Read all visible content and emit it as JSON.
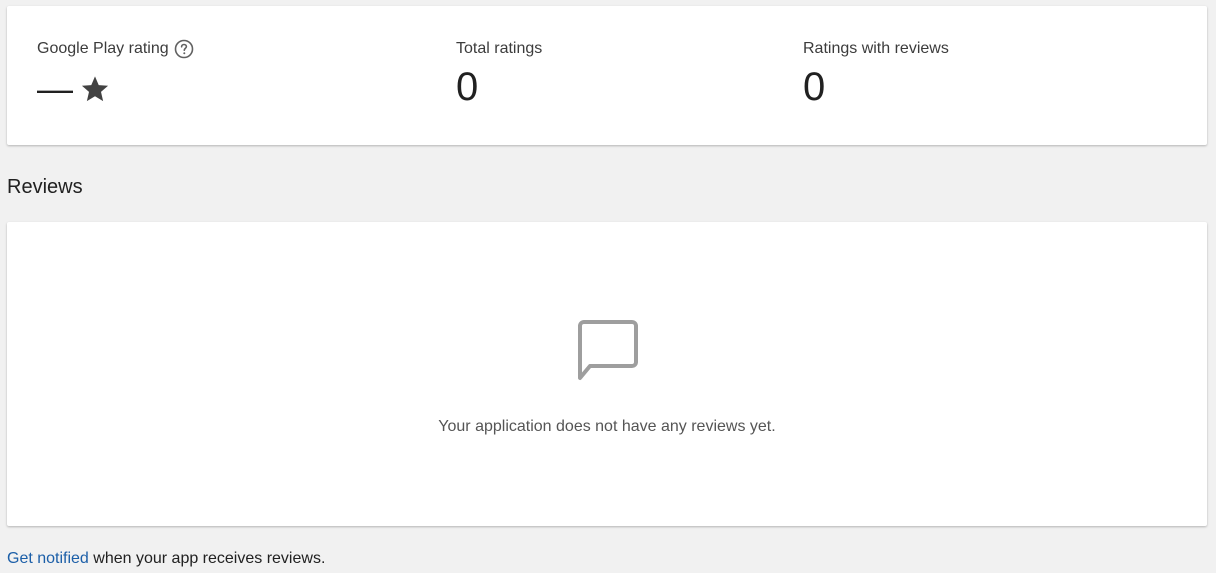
{
  "stats": {
    "rating": {
      "label": "Google Play rating",
      "value": "—",
      "help_icon": "help-circle-icon",
      "star_icon": "star-icon"
    },
    "total_ratings": {
      "label": "Total ratings",
      "value": "0"
    },
    "ratings_with_reviews": {
      "label": "Ratings with reviews",
      "value": "0"
    }
  },
  "reviews": {
    "title": "Reviews",
    "empty_icon": "chat-bubble-icon",
    "empty_message": "Your application does not have any reviews yet."
  },
  "footer": {
    "link_text": "Get notified",
    "rest_text": " when your app receives reviews."
  },
  "colors": {
    "background": "#f1f1f1",
    "card": "#ffffff",
    "link": "#1c5fa8",
    "icon": "#9e9e9e"
  }
}
